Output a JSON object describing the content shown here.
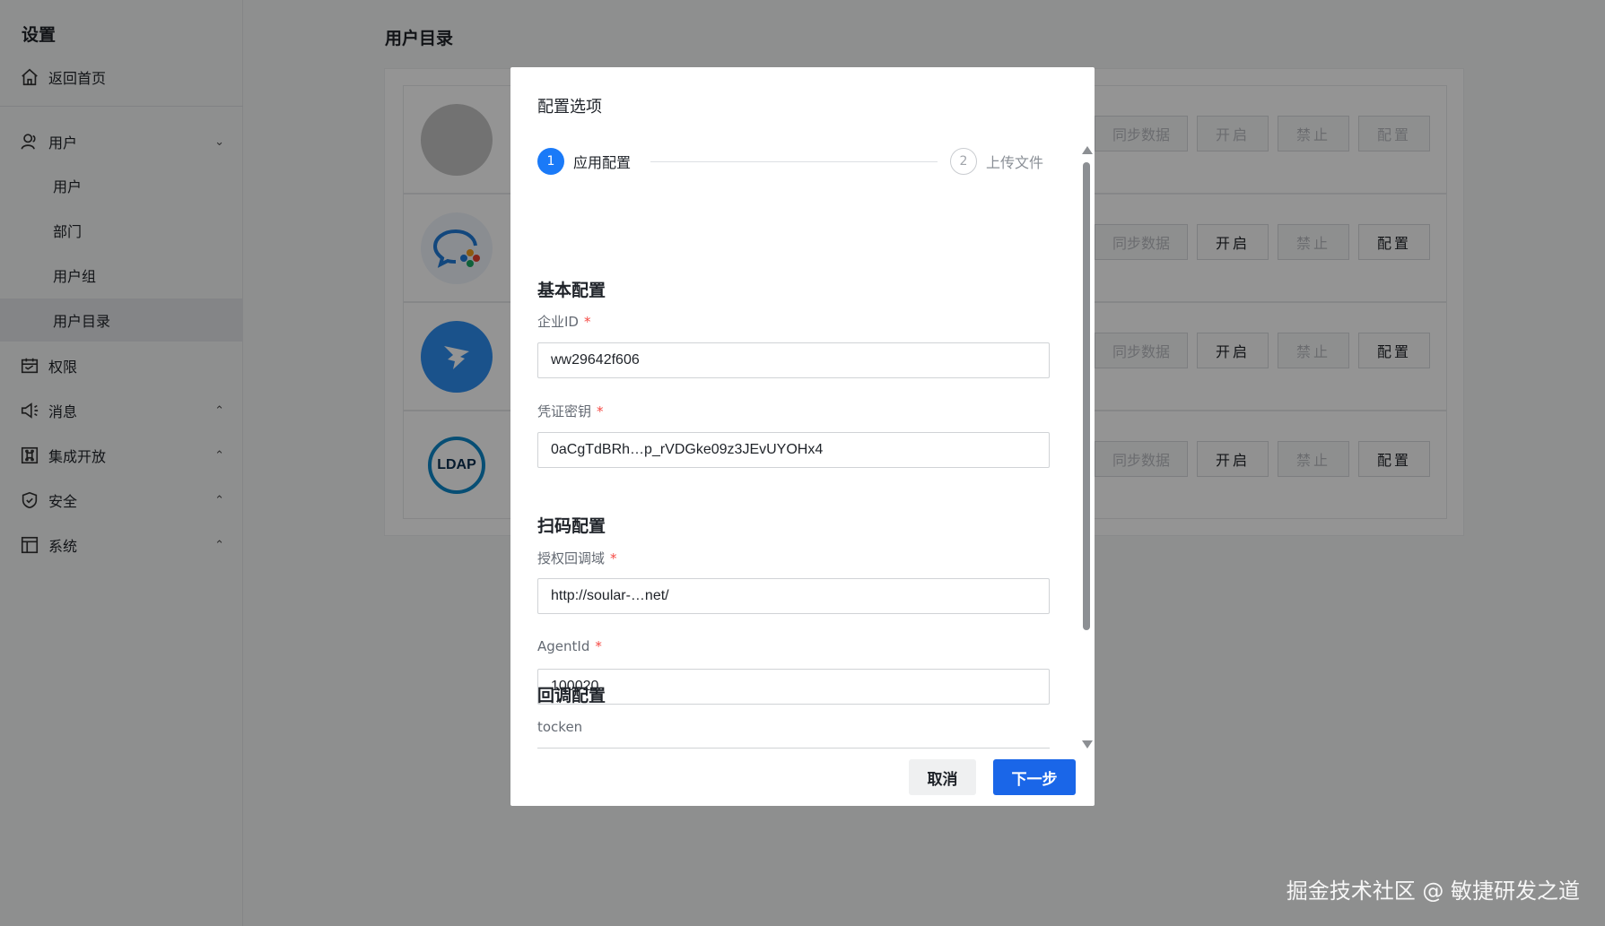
{
  "sidebar": {
    "title": "设置",
    "home": "返回首页",
    "items": [
      {
        "label": "用户",
        "chevron": "⌄"
      },
      {
        "label": "权限"
      },
      {
        "label": "消息",
        "chevron": "⌃"
      },
      {
        "label": "集成开放",
        "chevron": "⌃"
      },
      {
        "label": "安全",
        "chevron": "⌃"
      },
      {
        "label": "系统",
        "chevron": "⌃"
      }
    ],
    "sub_items": [
      "用户",
      "部门",
      "用户组",
      "用户目录"
    ],
    "active_sub": "用户目录"
  },
  "main": {
    "title": "用户目录",
    "rows": [
      {
        "logo": "gray-avatar",
        "buttons": [
          "同步数据",
          "开启",
          "禁止",
          "配置"
        ],
        "disabled": [
          true,
          true,
          true,
          true
        ]
      },
      {
        "logo": "wecom-icon",
        "buttons": [
          "同步数据",
          "开启",
          "禁止",
          "配置"
        ],
        "disabled": [
          true,
          false,
          true,
          false
        ]
      },
      {
        "logo": "dingtalk-icon",
        "buttons": [
          "同步数据",
          "开启",
          "禁止",
          "配置"
        ],
        "disabled": [
          true,
          false,
          true,
          false
        ]
      },
      {
        "logo": "ldap-icon",
        "logo_text": "LDAP",
        "buttons": [
          "同步数据",
          "开启",
          "禁止",
          "配置"
        ],
        "disabled": [
          true,
          false,
          true,
          false
        ]
      }
    ]
  },
  "modal": {
    "title": "配置选项",
    "steps": [
      {
        "num": "1",
        "label": "应用配置",
        "active": true
      },
      {
        "num": "2",
        "label": "上传文件",
        "active": false
      }
    ],
    "sections": {
      "basic": "基本配置",
      "scan": "扫码配置",
      "callback": "回调配置"
    },
    "fields": {
      "corp_id": {
        "label": "企业ID",
        "value": "ww29642f606"
      },
      "secret": {
        "label": "凭证密钥",
        "value": "0aCgTdBRh…p_rVDGke09z3JEvUYOHx4"
      },
      "auth_domain": {
        "label": "授权回调域",
        "value": "http://soular-…net/"
      },
      "agent_id": {
        "label": "AgentId",
        "value": "100020"
      },
      "token": {
        "label": "tocken",
        "value": ""
      }
    },
    "required_mark": "*",
    "cancel": "取消",
    "next": "下一步"
  },
  "watermark": "掘金技术社区 @ 敏捷研发之道",
  "colors": {
    "primary": "#1a66e8",
    "step_active": "#1a7af8",
    "required": "#f54a45"
  }
}
